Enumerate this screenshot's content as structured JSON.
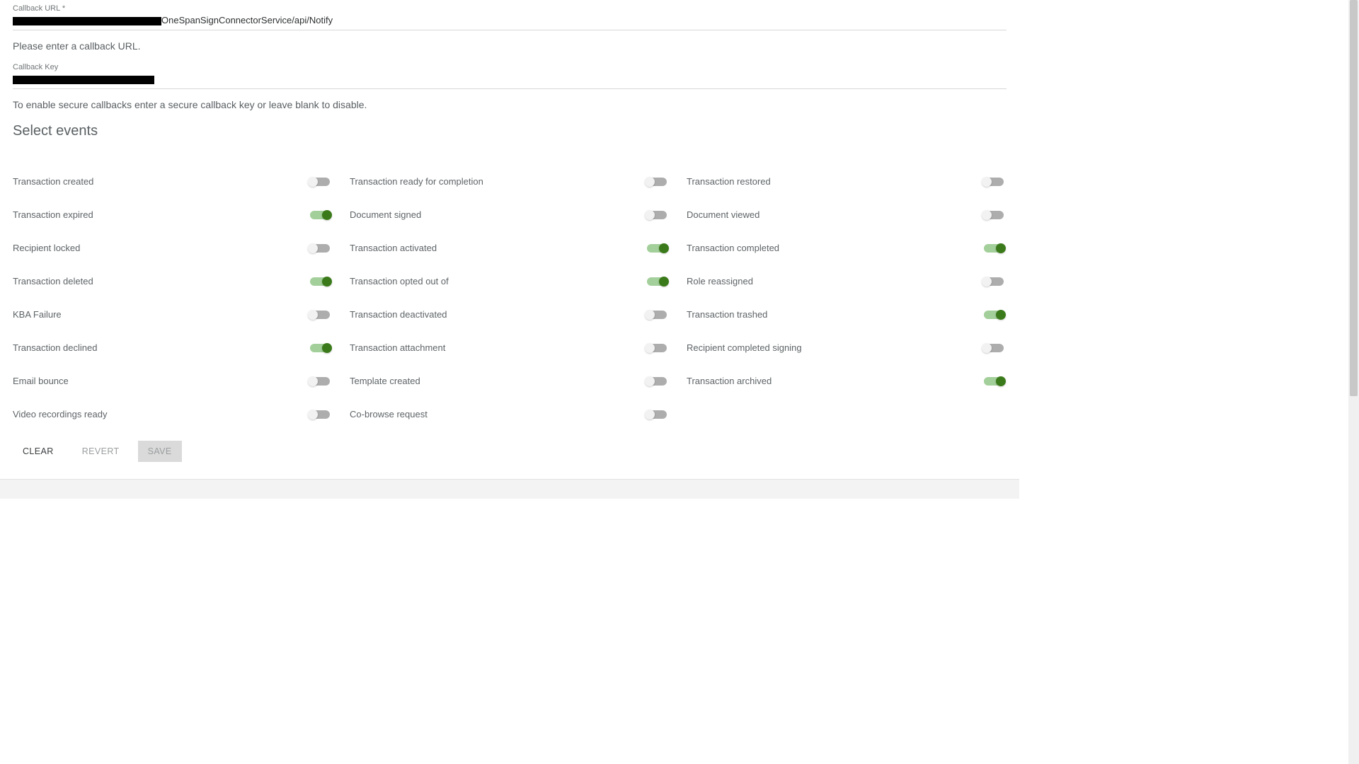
{
  "callbackUrl": {
    "label": "Callback URL *",
    "value_visible_suffix": "OneSpanSignConnectorService/api/Notify",
    "helper": "Please enter a callback URL."
  },
  "callbackKey": {
    "label": "Callback Key",
    "helper": "To enable secure callbacks enter a secure callback key or leave blank to disable."
  },
  "sectionTitle": "Select events",
  "events": {
    "col1": [
      {
        "label": "Transaction created",
        "on": false
      },
      {
        "label": "Transaction expired",
        "on": true
      },
      {
        "label": "Recipient locked",
        "on": false
      },
      {
        "label": "Transaction deleted",
        "on": true
      },
      {
        "label": "KBA Failure",
        "on": false
      },
      {
        "label": "Transaction declined",
        "on": true
      },
      {
        "label": "Email bounce",
        "on": false
      },
      {
        "label": "Video recordings ready",
        "on": false
      }
    ],
    "col2": [
      {
        "label": "Transaction ready for completion",
        "on": false
      },
      {
        "label": "Document signed",
        "on": false
      },
      {
        "label": "Transaction activated",
        "on": true
      },
      {
        "label": "Transaction opted out of",
        "on": true
      },
      {
        "label": "Transaction deactivated",
        "on": false
      },
      {
        "label": "Transaction attachment",
        "on": false
      },
      {
        "label": "Template created",
        "on": false
      },
      {
        "label": "Co-browse request",
        "on": false
      }
    ],
    "col3": [
      {
        "label": "Transaction restored",
        "on": false
      },
      {
        "label": "Document viewed",
        "on": false
      },
      {
        "label": "Transaction completed",
        "on": true
      },
      {
        "label": "Role reassigned",
        "on": false
      },
      {
        "label": "Transaction trashed",
        "on": true
      },
      {
        "label": "Recipient completed signing",
        "on": false
      },
      {
        "label": "Transaction archived",
        "on": true
      }
    ]
  },
  "buttons": {
    "clear": "CLEAR",
    "revert": "REVERT",
    "save": "SAVE"
  }
}
